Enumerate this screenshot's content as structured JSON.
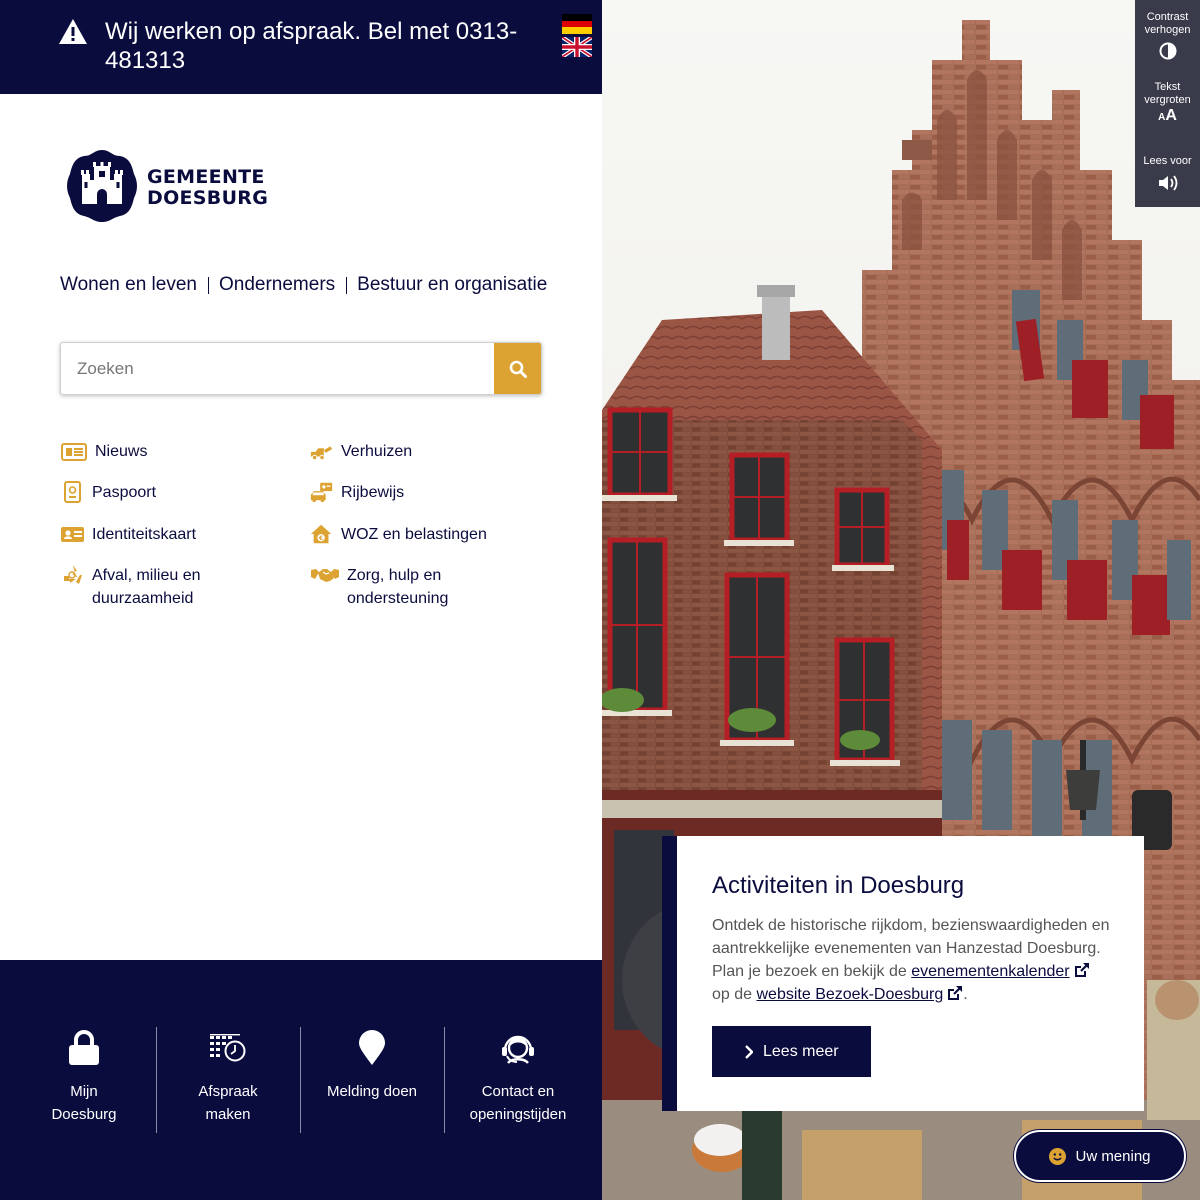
{
  "alert": {
    "text": "Wij werken op afspraak. Bel met 0313-481313",
    "icon": "warning-icon"
  },
  "languages": [
    {
      "name": "Deutsch",
      "icon": "german-flag-icon"
    },
    {
      "name": "English",
      "icon": "uk-flag-icon"
    }
  ],
  "logo": {
    "line1": "GEMEENTE",
    "line2": "DOESBURG"
  },
  "main_nav": [
    {
      "label": "Wonen en leven"
    },
    {
      "label": "Ondernemers"
    },
    {
      "label": "Bestuur en organisatie"
    }
  ],
  "search": {
    "placeholder": "Zoeken",
    "value": "",
    "button_icon": "search-icon"
  },
  "quick_links": [
    {
      "label": "Nieuws",
      "icon": "newspaper-icon"
    },
    {
      "label": "Verhuizen",
      "icon": "moving-truck-icon"
    },
    {
      "label": "Paspoort",
      "icon": "passport-icon"
    },
    {
      "label": "Rijbewijs",
      "icon": "driving-license-icon"
    },
    {
      "label": "Identiteitskaart",
      "icon": "id-card-icon"
    },
    {
      "label": "WOZ en belastingen",
      "icon": "house-euro-icon"
    },
    {
      "label": "Afval, milieu en duurzaamheid",
      "label_line1": "Afval, milieu en",
      "label_line2": "duurzaamheid",
      "icon": "recycle-icon"
    },
    {
      "label": "Zorg, hulp en ondersteuning",
      "label_line1": "Zorg, hulp en",
      "label_line2": "ondersteuning",
      "icon": "handshake-icon"
    }
  ],
  "footer_nav": [
    {
      "line1": "Mijn",
      "line2": "Doesburg",
      "icon": "lock-icon"
    },
    {
      "line1": "Afspraak",
      "line2": "maken",
      "icon": "calendar-clock-icon"
    },
    {
      "line1": "Melding doen",
      "line2": "",
      "icon": "map-pin-icon"
    },
    {
      "line1": "Contact en",
      "line2": "openingstijden",
      "icon": "support-agent-icon"
    }
  ],
  "accessibility": {
    "contrast_line1": "Contrast",
    "contrast_line2": "verhogen",
    "text_line1": "Tekst",
    "text_line2": "vergroten",
    "text_glyph": "AA",
    "read_label": "Lees voor"
  },
  "card": {
    "title": "Activiteiten in Doesburg",
    "body_start": "Ontdek de historische rijkdom, bezienswaardigheden en aantrekkelijke evenementen van Hanzestad Doesburg. Plan je bezoek en bekijk de",
    "link1": "evenementenkalender",
    "body_mid": "op de",
    "link2": "website Bezoek-Doesburg",
    "body_end": ".",
    "button": "Lees meer"
  },
  "feedback": {
    "label": "Uw mening"
  },
  "colors": {
    "navy": "#0b0c3e",
    "gold": "#dca332",
    "toolbar": "#3a3b4a"
  }
}
